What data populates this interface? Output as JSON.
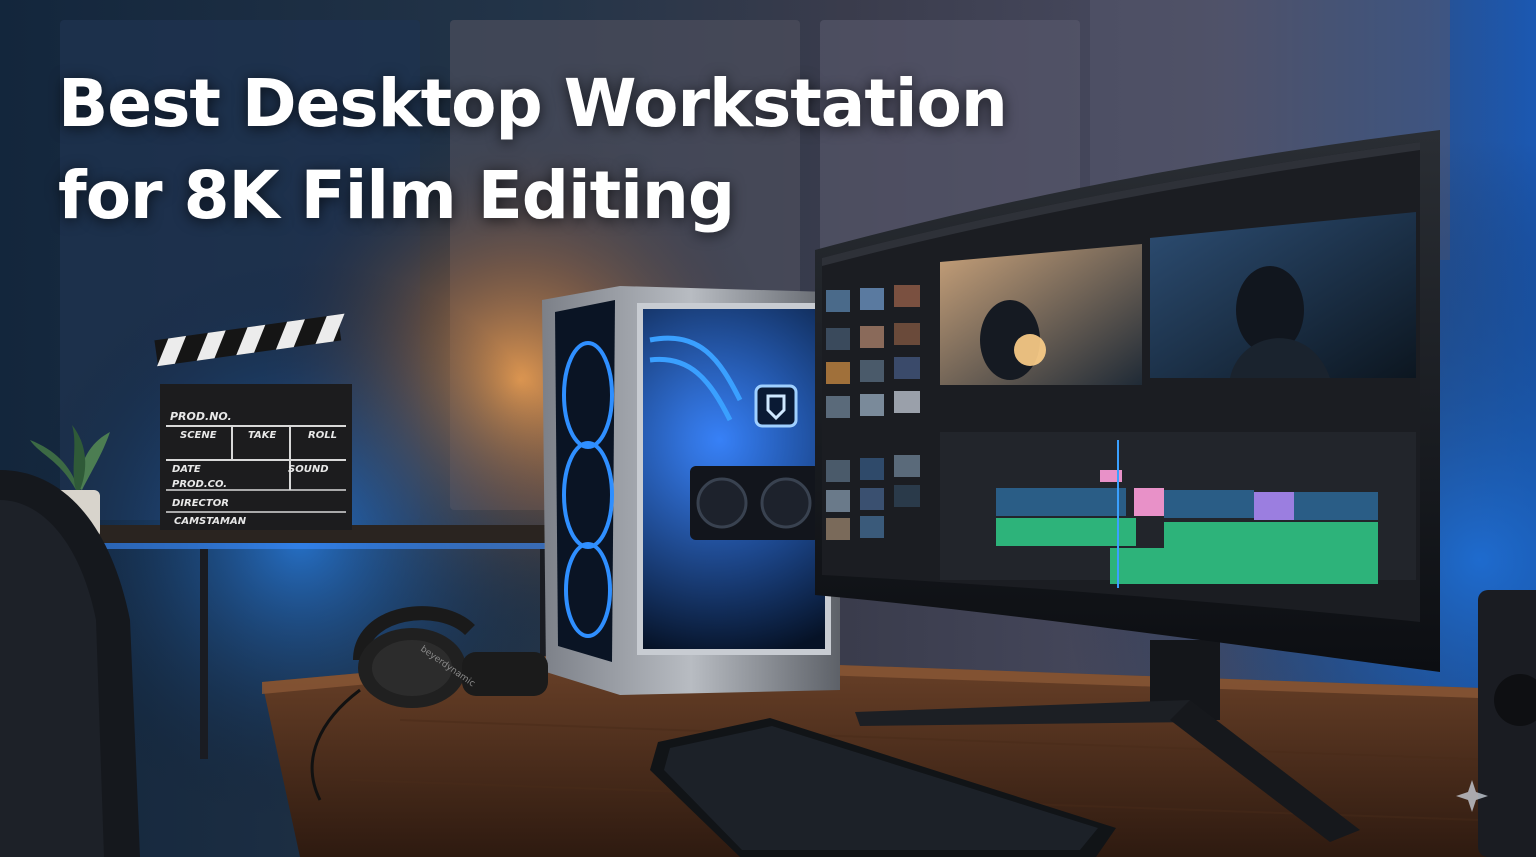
{
  "headline": {
    "line1": "Best Desktop Workstation",
    "line2": "for 8K Film Editing"
  },
  "clapperboard": {
    "labels": [
      "PROD.NO.",
      "SCENE",
      "TAKE",
      "ROLL",
      "DATE",
      "SOUND",
      "PROD.CO.",
      "DIRECTOR",
      "CAMSTAMAN"
    ]
  },
  "headphones": {
    "brand": "beyerdynamic"
  },
  "colors": {
    "accent_blue": "#2f8fff",
    "warm_lamp": "#f0a050",
    "timeline_green": "#2db37a",
    "timeline_pink": "#e891c8",
    "timeline_purple": "#9b7ee0"
  }
}
